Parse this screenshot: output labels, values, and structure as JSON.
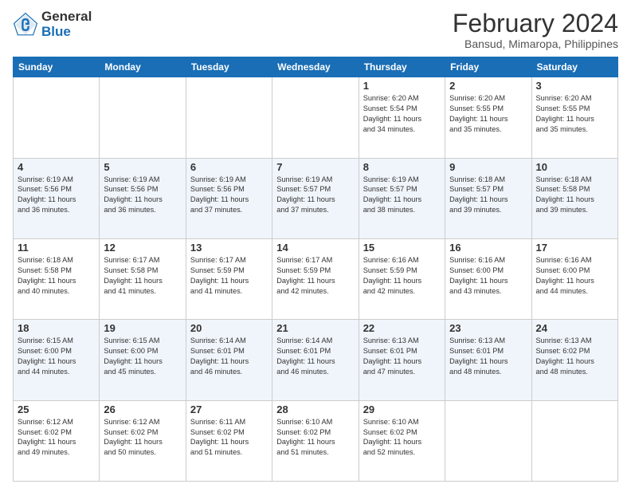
{
  "header": {
    "logo_line1": "General",
    "logo_line2": "Blue",
    "title": "February 2024",
    "subtitle": "Bansud, Mimaropa, Philippines"
  },
  "days_of_week": [
    "Sunday",
    "Monday",
    "Tuesday",
    "Wednesday",
    "Thursday",
    "Friday",
    "Saturday"
  ],
  "weeks": [
    [
      {
        "day": "",
        "info": ""
      },
      {
        "day": "",
        "info": ""
      },
      {
        "day": "",
        "info": ""
      },
      {
        "day": "",
        "info": ""
      },
      {
        "day": "1",
        "info": "Sunrise: 6:20 AM\nSunset: 5:54 PM\nDaylight: 11 hours\nand 34 minutes."
      },
      {
        "day": "2",
        "info": "Sunrise: 6:20 AM\nSunset: 5:55 PM\nDaylight: 11 hours\nand 35 minutes."
      },
      {
        "day": "3",
        "info": "Sunrise: 6:20 AM\nSunset: 5:55 PM\nDaylight: 11 hours\nand 35 minutes."
      }
    ],
    [
      {
        "day": "4",
        "info": "Sunrise: 6:19 AM\nSunset: 5:56 PM\nDaylight: 11 hours\nand 36 minutes."
      },
      {
        "day": "5",
        "info": "Sunrise: 6:19 AM\nSunset: 5:56 PM\nDaylight: 11 hours\nand 36 minutes."
      },
      {
        "day": "6",
        "info": "Sunrise: 6:19 AM\nSunset: 5:56 PM\nDaylight: 11 hours\nand 37 minutes."
      },
      {
        "day": "7",
        "info": "Sunrise: 6:19 AM\nSunset: 5:57 PM\nDaylight: 11 hours\nand 37 minutes."
      },
      {
        "day": "8",
        "info": "Sunrise: 6:19 AM\nSunset: 5:57 PM\nDaylight: 11 hours\nand 38 minutes."
      },
      {
        "day": "9",
        "info": "Sunrise: 6:18 AM\nSunset: 5:57 PM\nDaylight: 11 hours\nand 39 minutes."
      },
      {
        "day": "10",
        "info": "Sunrise: 6:18 AM\nSunset: 5:58 PM\nDaylight: 11 hours\nand 39 minutes."
      }
    ],
    [
      {
        "day": "11",
        "info": "Sunrise: 6:18 AM\nSunset: 5:58 PM\nDaylight: 11 hours\nand 40 minutes."
      },
      {
        "day": "12",
        "info": "Sunrise: 6:17 AM\nSunset: 5:58 PM\nDaylight: 11 hours\nand 41 minutes."
      },
      {
        "day": "13",
        "info": "Sunrise: 6:17 AM\nSunset: 5:59 PM\nDaylight: 11 hours\nand 41 minutes."
      },
      {
        "day": "14",
        "info": "Sunrise: 6:17 AM\nSunset: 5:59 PM\nDaylight: 11 hours\nand 42 minutes."
      },
      {
        "day": "15",
        "info": "Sunrise: 6:16 AM\nSunset: 5:59 PM\nDaylight: 11 hours\nand 42 minutes."
      },
      {
        "day": "16",
        "info": "Sunrise: 6:16 AM\nSunset: 6:00 PM\nDaylight: 11 hours\nand 43 minutes."
      },
      {
        "day": "17",
        "info": "Sunrise: 6:16 AM\nSunset: 6:00 PM\nDaylight: 11 hours\nand 44 minutes."
      }
    ],
    [
      {
        "day": "18",
        "info": "Sunrise: 6:15 AM\nSunset: 6:00 PM\nDaylight: 11 hours\nand 44 minutes."
      },
      {
        "day": "19",
        "info": "Sunrise: 6:15 AM\nSunset: 6:00 PM\nDaylight: 11 hours\nand 45 minutes."
      },
      {
        "day": "20",
        "info": "Sunrise: 6:14 AM\nSunset: 6:01 PM\nDaylight: 11 hours\nand 46 minutes."
      },
      {
        "day": "21",
        "info": "Sunrise: 6:14 AM\nSunset: 6:01 PM\nDaylight: 11 hours\nand 46 minutes."
      },
      {
        "day": "22",
        "info": "Sunrise: 6:13 AM\nSunset: 6:01 PM\nDaylight: 11 hours\nand 47 minutes."
      },
      {
        "day": "23",
        "info": "Sunrise: 6:13 AM\nSunset: 6:01 PM\nDaylight: 11 hours\nand 48 minutes."
      },
      {
        "day": "24",
        "info": "Sunrise: 6:13 AM\nSunset: 6:02 PM\nDaylight: 11 hours\nand 48 minutes."
      }
    ],
    [
      {
        "day": "25",
        "info": "Sunrise: 6:12 AM\nSunset: 6:02 PM\nDaylight: 11 hours\nand 49 minutes."
      },
      {
        "day": "26",
        "info": "Sunrise: 6:12 AM\nSunset: 6:02 PM\nDaylight: 11 hours\nand 50 minutes."
      },
      {
        "day": "27",
        "info": "Sunrise: 6:11 AM\nSunset: 6:02 PM\nDaylight: 11 hours\nand 51 minutes."
      },
      {
        "day": "28",
        "info": "Sunrise: 6:10 AM\nSunset: 6:02 PM\nDaylight: 11 hours\nand 51 minutes."
      },
      {
        "day": "29",
        "info": "Sunrise: 6:10 AM\nSunset: 6:02 PM\nDaylight: 11 hours\nand 52 minutes."
      },
      {
        "day": "",
        "info": ""
      },
      {
        "day": "",
        "info": ""
      }
    ]
  ]
}
